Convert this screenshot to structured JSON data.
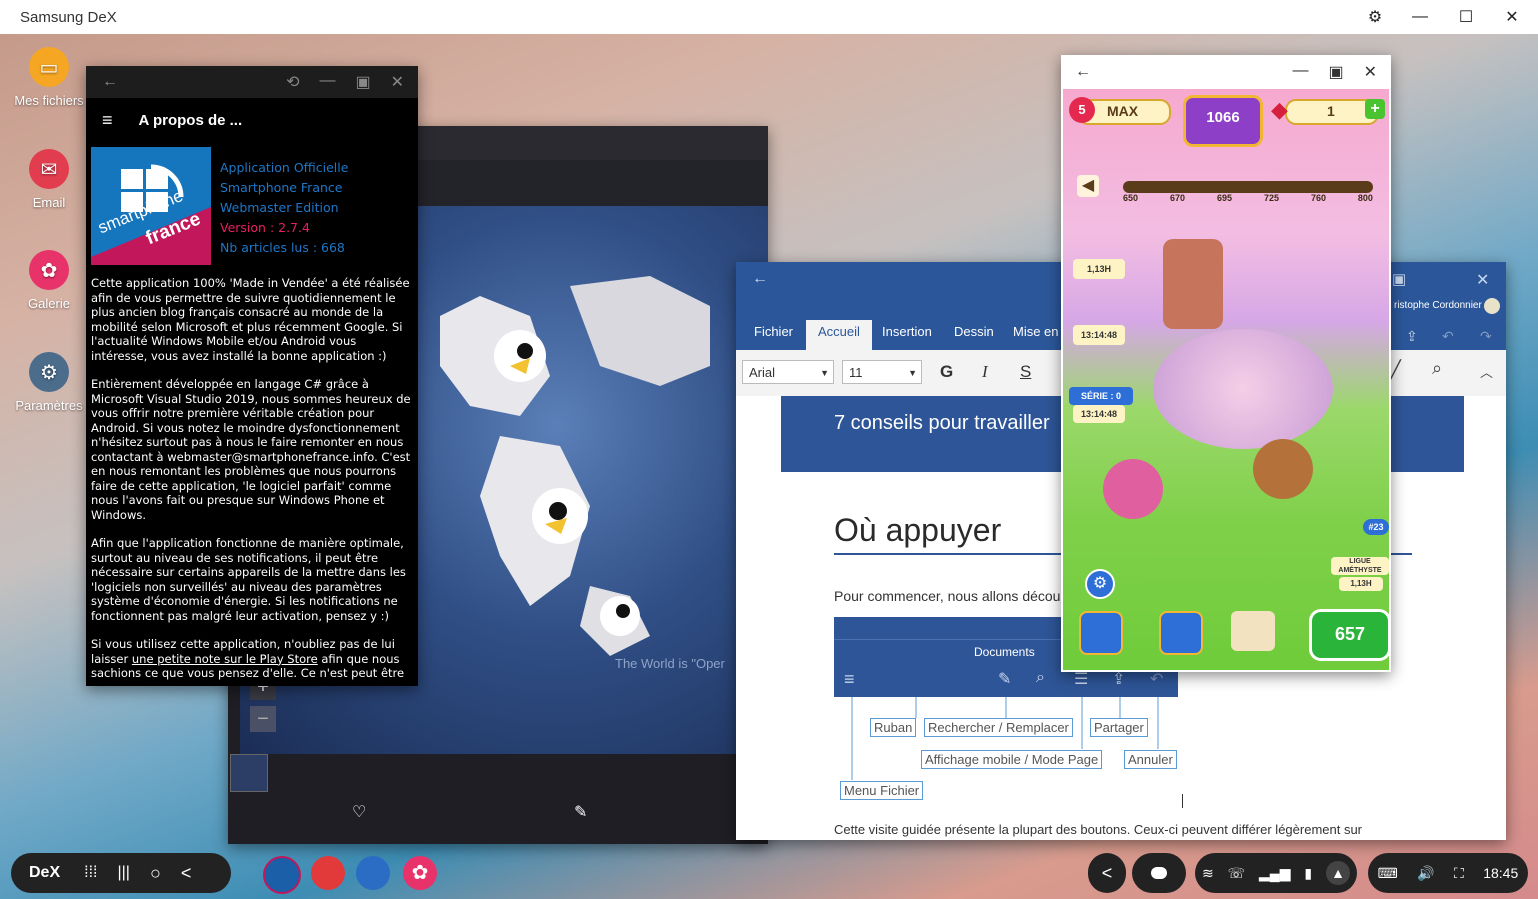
{
  "host": {
    "title": "Samsung DeX"
  },
  "desktop_icons": [
    {
      "label": "Mes fichiers",
      "icon": "folder-icon",
      "color": "#f5a623"
    },
    {
      "label": "Email",
      "icon": "mail-icon",
      "color": "#e23d4e"
    },
    {
      "label": "Galerie",
      "icon": "flower-icon",
      "color": "#e8336a"
    },
    {
      "label": "Paramètres",
      "icon": "gear-icon",
      "color": "#4c6c8c"
    }
  ],
  "about": {
    "header": "A propos de ...",
    "info": [
      "Application Officielle",
      "Smartphone France",
      "Webmaster Edition"
    ],
    "version": "Version : 2.7.4",
    "articles": "Nb articles lus : 668",
    "logo_text_1": "smartphone",
    "logo_text_2": "france",
    "p1": "Cette application 100% 'Made in Vendée' a été réalisée afin de vous permettre de suivre quotidiennement le plus ancien blog français consacré au monde de la mobilité selon Microsoft et plus récemment Google. Si l'actualité Windows Mobile et/ou Android vous intéresse, vous avez installé la bonne application :)",
    "p2": "Entièrement développée en langage C# grâce à Microsoft Visual Studio 2019, nous sommes heureux de vous offrir notre première véritable création pour Android. Si vous notez le moindre dysfonctionnement n'hésitez surtout pas à nous le faire remonter en nous contactant à webmaster@smartphonefrance.info. C'est en nous remontant les problèmes que nous pourrons faire de cette application, 'le logiciel parfait' comme nous l'avons fait ou presque sur Windows Phone et Windows.",
    "p3": "Afin que l'application fonctionne de manière optimale, surtout au niveau de ses notifications, il peut être nécessaire sur certains appareils de la mettre dans les 'logiciels non surveillés' au niveau des paramètres système d'économie d'énergie. Si les notifications ne fonctionnent pas malgré leur activation, pensez y :)",
    "p4_a": "Si vous utilisez cette application, n'oubliez pas de lui laisser ",
    "p4_link": "une petite note sur le Play Store",
    "p4_b": " afin que nous sachions ce que vous pensez d'elle. Ce n'est peut être"
  },
  "viewer": {
    "caption": "The World is \"Oper",
    "zoom_in": "+",
    "zoom_out": "−"
  },
  "word": {
    "tabs": [
      "Fichier",
      "Accueil",
      "Insertion",
      "Dessin",
      "Mise en"
    ],
    "account": "ristophe Cordonnier",
    "font": "Arial",
    "size": "11",
    "fmt": {
      "bold": "G",
      "italic": "I",
      "underline": "S"
    },
    "banner": "7 conseils pour travailler",
    "heading": "Où appuyer",
    "intro": "Pour commencer, nous allons décou",
    "app_title": "Documents",
    "labels": [
      "Ruban",
      "Rechercher / Remplacer",
      "Partager",
      "Affichage mobile / Mode Page",
      "Annuler",
      "Menu Fichier"
    ],
    "footer": "Cette visite guidée présente la plupart des boutons. Ceux-ci peuvent différer légèrement sur"
  },
  "game": {
    "lives": "5",
    "lives_label": "MAX",
    "stars": "1066",
    "gems": "1",
    "milestones": [
      "650",
      "670",
      "695",
      "725",
      "760",
      "800"
    ],
    "timer1": "1,13H",
    "timer2": "13:14:48",
    "series": "SÉRIE : 0",
    "timer3": "13:14:48",
    "badge": "#23",
    "league": "LIGUE AMÉTHYSTE",
    "league_time": "1,13H",
    "level": "657"
  },
  "taskbar": {
    "dex": "DeX",
    "clock": "18:45"
  }
}
